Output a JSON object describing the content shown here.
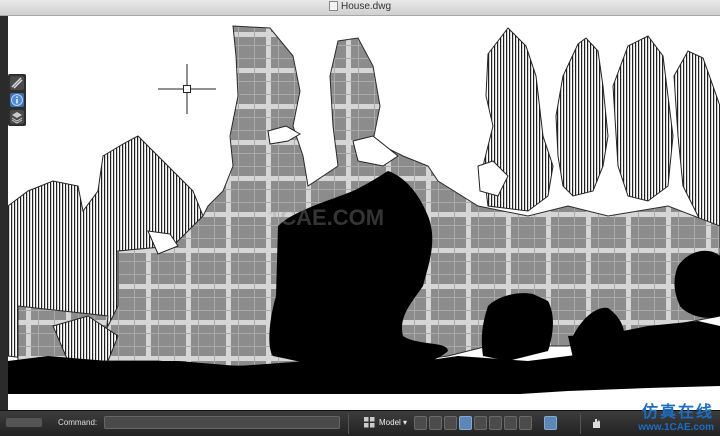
{
  "window": {
    "title": "House.dwg"
  },
  "palette": {
    "items": [
      "layers-icon",
      "info-icon",
      "stack-icon"
    ]
  },
  "statusbar": {
    "command_label": "Command:",
    "space_label": "Model"
  },
  "watermark": {
    "text": "1CAE.COM"
  },
  "brand": {
    "cn_text": "仿真在线",
    "url": "www.1CAE.com"
  },
  "colors": {
    "statusbar": "#2b2b2b",
    "accent": "#1a6fc4"
  }
}
